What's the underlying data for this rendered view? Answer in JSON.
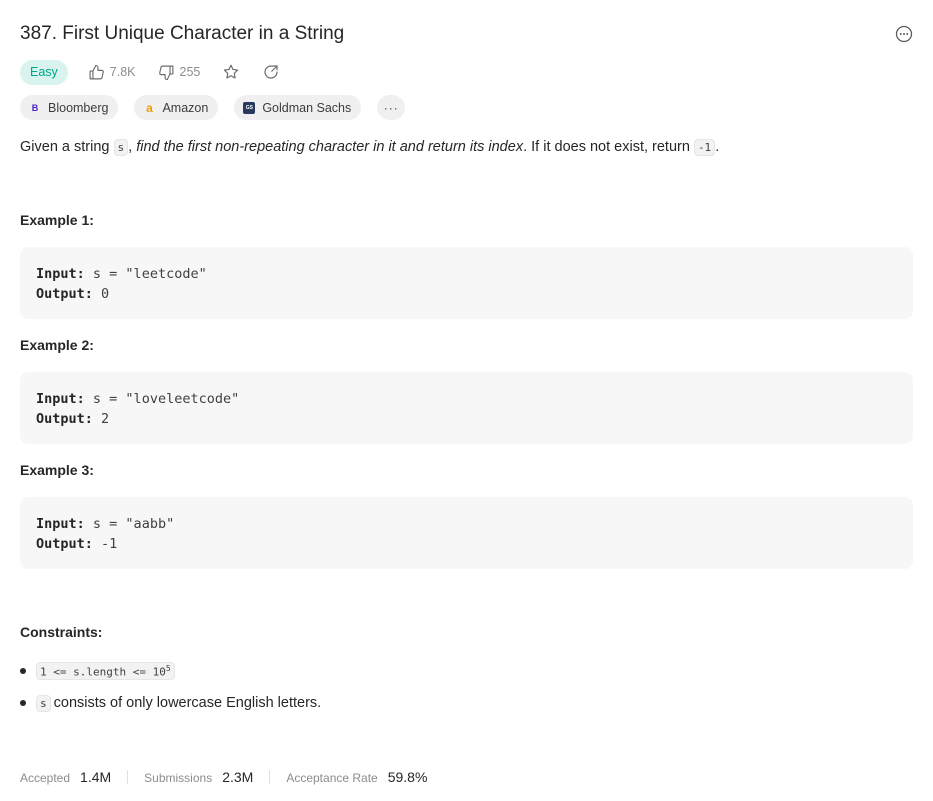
{
  "problem": {
    "title": "387. First Unique Character in a String",
    "difficulty": "Easy",
    "likes": "7.8K",
    "dislikes": "255"
  },
  "icons": {
    "more": "more-horizontal-circle-icon",
    "like": "thumbs-up-icon",
    "dislike": "thumbs-down-icon",
    "favorite": "star-icon",
    "share": "share-icon"
  },
  "tags": [
    {
      "name": "Bloomberg",
      "logo": "B"
    },
    {
      "name": "Amazon",
      "logo": "a"
    },
    {
      "name": "Goldman Sachs",
      "logo": "GS"
    }
  ],
  "tags_more": "···",
  "description": {
    "part1": "Given a string ",
    "code_s": "s",
    "part2": ", ",
    "italic": "find the first non-repeating character in it and return its index",
    "part3": ". If it does not exist, return ",
    "code_neg1": "-1",
    "part4": "."
  },
  "examples": [
    {
      "heading": "Example 1:",
      "input_label": "Input:",
      "input": "s = \"leetcode\"",
      "output_label": "Output:",
      "output": "0"
    },
    {
      "heading": "Example 2:",
      "input_label": "Input:",
      "input": "s = \"loveleetcode\"",
      "output_label": "Output:",
      "output": "2"
    },
    {
      "heading": "Example 3:",
      "input_label": "Input:",
      "input": "s = \"aabb\"",
      "output_label": "Output:",
      "output": "-1"
    }
  ],
  "constraints": {
    "heading": "Constraints:",
    "c1_code": "1 <= s.length <= 10",
    "c1_sup": "5",
    "c2_code": "s",
    "c2_text": " consists of only lowercase English letters."
  },
  "footer": {
    "accepted_label": "Accepted",
    "accepted_value": "1.4M",
    "submissions_label": "Submissions",
    "submissions_value": "2.3M",
    "rate_label": "Acceptance Rate",
    "rate_value": "59.8%"
  },
  "colors": {
    "easy_bg": "#d9f4ef",
    "easy_text": "#00a58a",
    "muted": "#8c8c8c"
  }
}
